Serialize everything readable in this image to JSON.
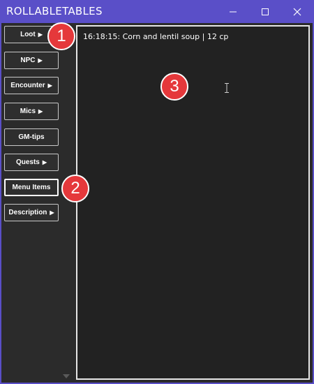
{
  "window": {
    "title": "ROLLABLETABLES"
  },
  "sidebar": {
    "items": [
      {
        "label": "Loot",
        "arrow": "▶"
      },
      {
        "label": "NPC",
        "arrow": "▶"
      },
      {
        "label": "Encounter",
        "arrow": "▶"
      },
      {
        "label": "Mics",
        "arrow": "▶"
      },
      {
        "label": "GM-tips",
        "arrow": ""
      },
      {
        "label": "Quests",
        "arrow": "▶"
      },
      {
        "label": "Menu Items",
        "arrow": ""
      },
      {
        "label": "Description",
        "arrow": "▶"
      }
    ]
  },
  "output": {
    "lines": [
      "16:18:15: Corn and lentil soup | 12 cp"
    ]
  },
  "annotations": [
    "1",
    "2",
    "3"
  ],
  "colors": {
    "titlebar": "#5a4fc8",
    "panel": "#2b2b2b",
    "badge": "#e5383b"
  }
}
